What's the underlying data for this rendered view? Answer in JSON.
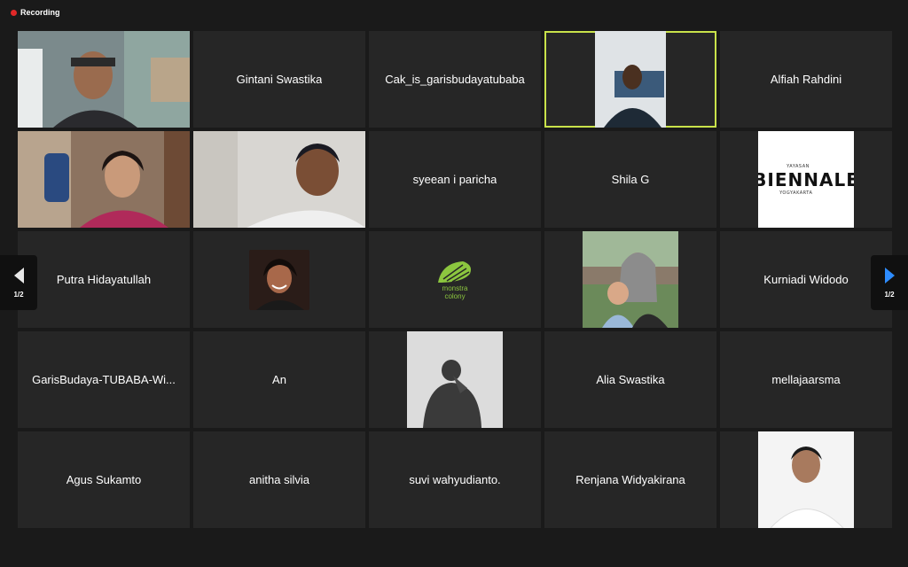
{
  "recording": {
    "label": "Recording"
  },
  "participants": [
    {
      "name": "",
      "kind": "video"
    },
    {
      "name": "Gintani Swastika"
    },
    {
      "name": "Cak_is_garisbudayatubaba"
    },
    {
      "name": "",
      "kind": "video-speaker"
    },
    {
      "name": "Alfiah Rahdini"
    },
    {
      "name": "",
      "kind": "video"
    },
    {
      "name": "",
      "kind": "video"
    },
    {
      "name": "syeean i paricha"
    },
    {
      "name": "Shila G"
    },
    {
      "name": "",
      "kind": "biennale-logo"
    },
    {
      "name": "Putra Hidayatullah"
    },
    {
      "name": "",
      "kind": "avatar"
    },
    {
      "name": "",
      "kind": "monstera-logo"
    },
    {
      "name": "",
      "kind": "avatar"
    },
    {
      "name": "Kurniadi Widodo"
    },
    {
      "name": "GarisBudaya-TUBABA-Wi..."
    },
    {
      "name": "An"
    },
    {
      "name": "",
      "kind": "avatar"
    },
    {
      "name": "Alia Swastika"
    },
    {
      "name": "mellajaarsma"
    },
    {
      "name": "Agus Sukamto"
    },
    {
      "name": "anitha silvia"
    },
    {
      "name": "suvi wahyudianto."
    },
    {
      "name": "Renjana Widyakirana"
    },
    {
      "name": "",
      "kind": "avatar"
    }
  ],
  "biennale": {
    "word": "BIENNALE",
    "top": "YAYASAN",
    "bottom": "YOGYAKARTA"
  },
  "monstera": {
    "line1": "monstra",
    "line2": "colony"
  },
  "pager": {
    "left": "1/2",
    "right": "1/2"
  },
  "colors": {
    "active_border": "#c9e24a",
    "next_arrow": "#2d8cff",
    "recording_dot": "#e02828"
  }
}
